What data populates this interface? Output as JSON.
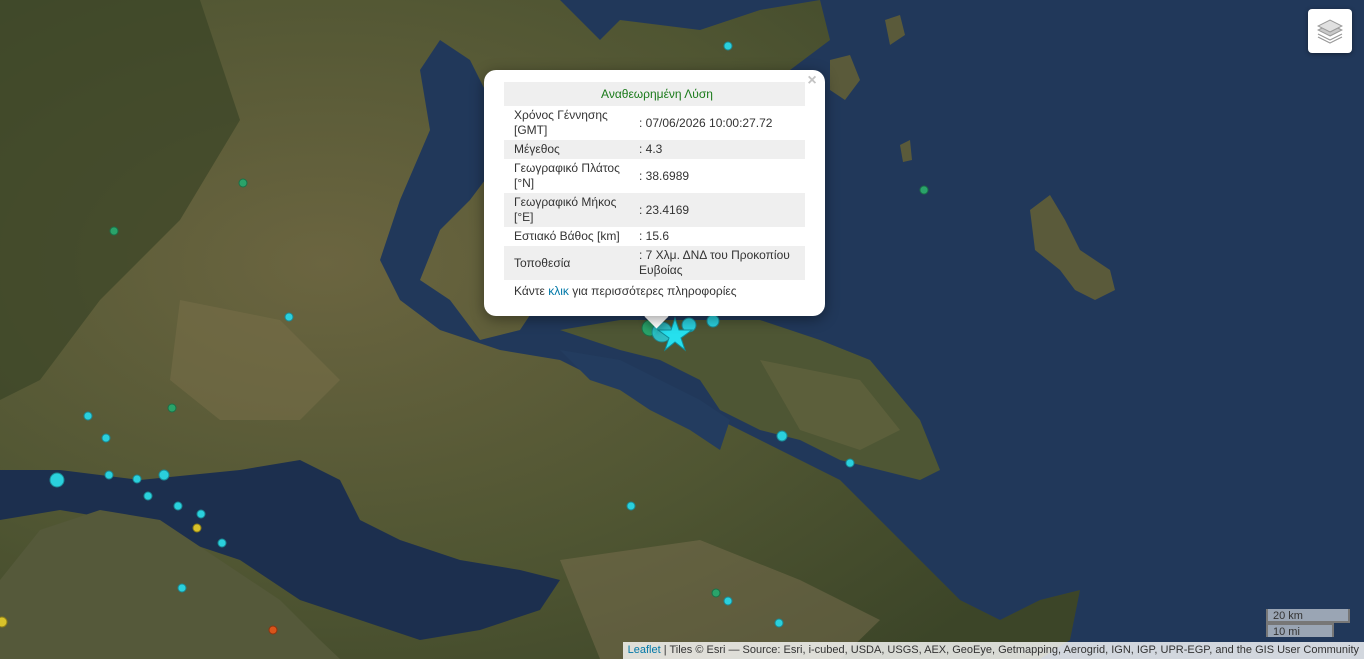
{
  "map": {
    "layers_icon": "layers-icon",
    "colors": {
      "sea": "#1f3550",
      "land": "#5c5a38",
      "land_dark": "#3f4a2a",
      "event_star": "#26e0ee"
    },
    "scale": {
      "km": "20 km",
      "mi": "10 mi"
    },
    "attribution": {
      "leaflet": "Leaflet",
      "separator": " | ",
      "tiles_text": "Tiles © Esri — Source: Esri, i-cubed, USDA, USGS, AEX, GeoEye, Getmapping, Aerogrid, IGN, IGP, UPR-EGP, and the GIS User Community"
    }
  },
  "popup": {
    "close": "×",
    "title": "Αναθεωρημένη Λύση",
    "rows": [
      {
        "label": "Χρόνος Γέννησης [GMT]",
        "value": ": 07/06/2026 10:00:27.72"
      },
      {
        "label": "Μέγεθος",
        "value": ": 4.3"
      },
      {
        "label": "Γεωγραφικό Πλάτος [°N]",
        "value": ": 38.6989"
      },
      {
        "label": "Γεωγραφικό Μήκος [°E]",
        "value": ": 23.4169"
      },
      {
        "label": "Εστιακό Βάθος [km]",
        "value": ": 15.6"
      },
      {
        "label": "Τοποθεσία",
        "value": ": 7 Χλμ. ΔΝΔ του Προκοπίου Ευβοίας"
      }
    ],
    "more_prefix": "Κάντε ",
    "more_link": "κλικ",
    "more_suffix": " για περισσότερες πληροφορίες"
  }
}
